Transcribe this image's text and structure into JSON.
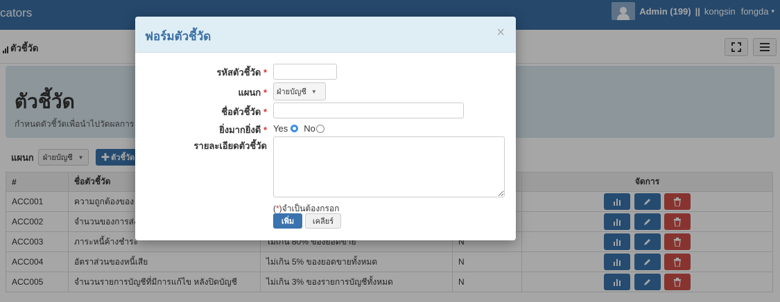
{
  "navbar": {
    "brand": "cators",
    "user": "Admin (199)",
    "separator": "||",
    "account": "kongsin",
    "org": "fongda",
    "caret": "▾"
  },
  "breadcrumb": {
    "title": "ตัวชี้วัด"
  },
  "jumbotron": {
    "title": "ตัวชี้วัด",
    "subtitle": "กำหนดตัวชี้วัดเพื่อนำไปวัดผลการ"
  },
  "filter": {
    "label": "แผนก",
    "selected": "ฝ่ายบัญชี",
    "add_label": "ตัวชี้วัด"
  },
  "table": {
    "headers": [
      "#",
      "ชื่อตัวชี้วัด",
      "",
      "",
      "จัดการ"
    ],
    "rows": [
      [
        "ACC001",
        "ความถูกต้องของ",
        "",
        ""
      ],
      [
        "ACC002",
        "จำนวนของการส่ง",
        "",
        ""
      ],
      [
        "ACC003",
        "ภาระหนี้ค้างชำระ",
        "ไม่เกิน 80% ของยอดขาย",
        "N"
      ],
      [
        "ACC004",
        "อัตราส่วนของหนี้เสีย",
        "ไม่เกิน 5% ของยอดขายทั้งหมด",
        "N"
      ],
      [
        "ACC005",
        "จำนวนรายการบัญชีที่มีการแก้ไข หลังปิดบัญชี",
        "ไม่เกิน 3% ของรายการบัญชีทั้งหมด",
        "N"
      ]
    ]
  },
  "modal": {
    "title": "ฟอร์มตัวชี้วัด",
    "close": "×",
    "code_label": "รหัสตัวชี้วัด",
    "dept_label": "แผนก",
    "dept_selected": "ฝ่ายบัญชี",
    "name_label": "ชื่อตัวชี้วัด",
    "higher_label": "ยิ่งมากยิ่งดี",
    "yes_label": "Yes",
    "no_label": "No",
    "detail_label": "รายละเอียดตัวชี้วัด",
    "required_mark": "*",
    "note_prefix": "(",
    "note_suffix": ")จำเป็นต้องกรอก",
    "submit_label": "เพิ่ม",
    "clear_label": "เคลียร์"
  },
  "colors": {
    "navbar": "#3a6fa5",
    "primary": "#3a73ad",
    "danger": "#d0514b",
    "modal_header": "#dfeef5",
    "jumbotron": "#d8e6ee"
  }
}
